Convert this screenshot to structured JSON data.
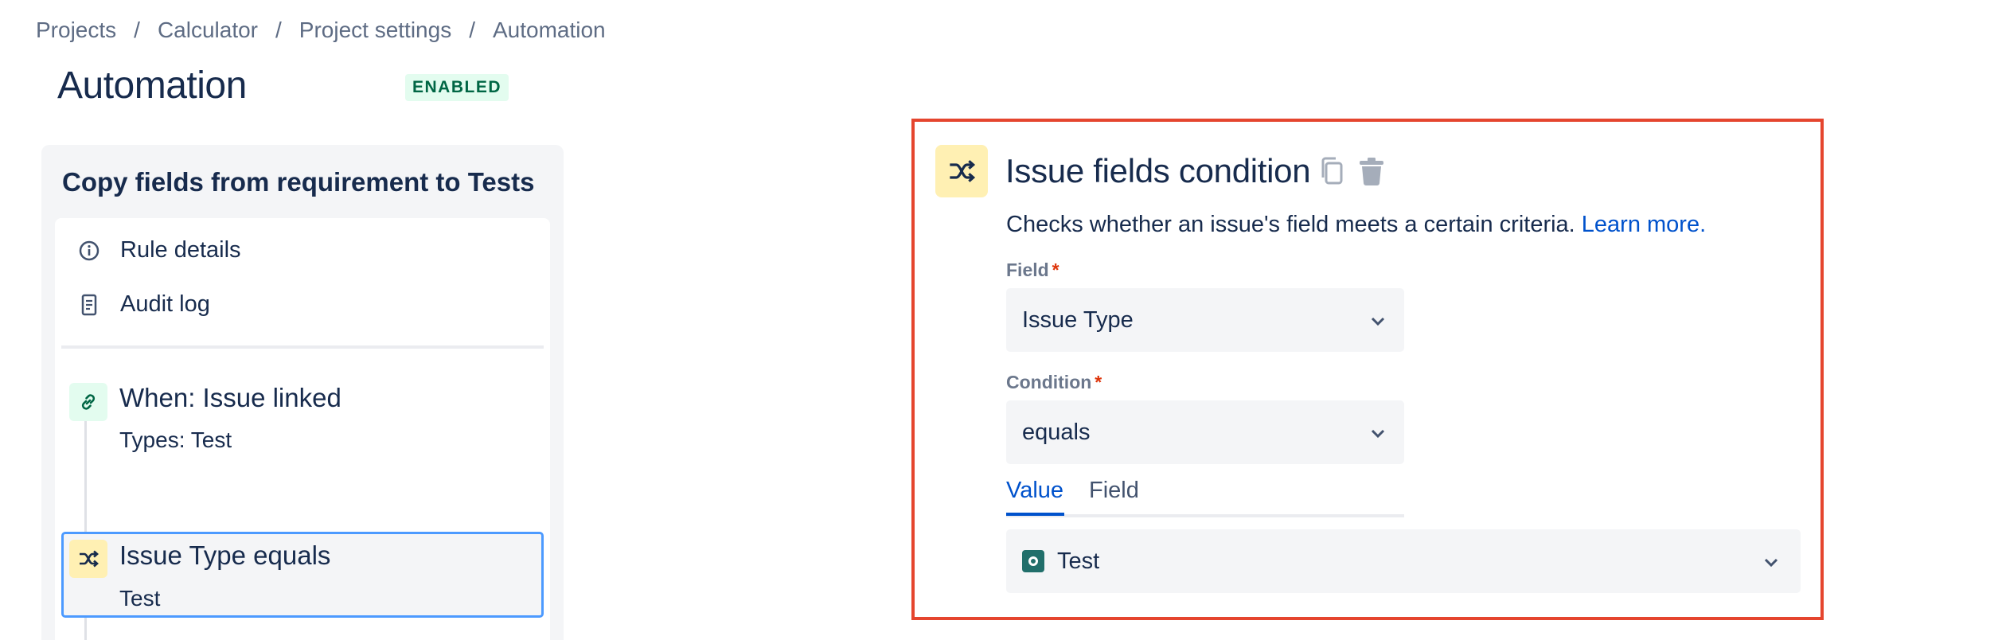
{
  "breadcrumb": {
    "items": [
      "Projects",
      "Calculator",
      "Project settings",
      "Automation"
    ],
    "separator": "/"
  },
  "header": {
    "title": "Automation",
    "status": "ENABLED"
  },
  "rule": {
    "name": "Copy fields from requirement to Tests",
    "menu": [
      {
        "label": "Rule details",
        "icon": "info-icon"
      },
      {
        "label": "Audit log",
        "icon": "document-icon"
      }
    ],
    "steps": [
      {
        "title": "When: Issue linked",
        "subtitle": "Types: Test",
        "icon": "link-icon"
      },
      {
        "title": "Issue Type equals",
        "subtitle": "Test",
        "icon": "shuffle-icon",
        "selected": true
      }
    ]
  },
  "detail": {
    "icon": "shuffle-icon",
    "title": "Issue fields condition",
    "description": "Checks whether an issue's field meets a certain criteria.",
    "learn_more": "Learn more.",
    "field_label": "Field",
    "field_value": "Issue Type",
    "condition_label": "Condition",
    "condition_value": "equals",
    "required_mark": "*",
    "tabs": [
      "Value",
      "Field"
    ],
    "active_tab": "Value",
    "value": "Test"
  },
  "colors": {
    "accent": "#0052cc",
    "highlight_border": "#e5452e",
    "enabled_badge_bg": "#e3fcef",
    "enabled_badge_text": "#006644"
  }
}
